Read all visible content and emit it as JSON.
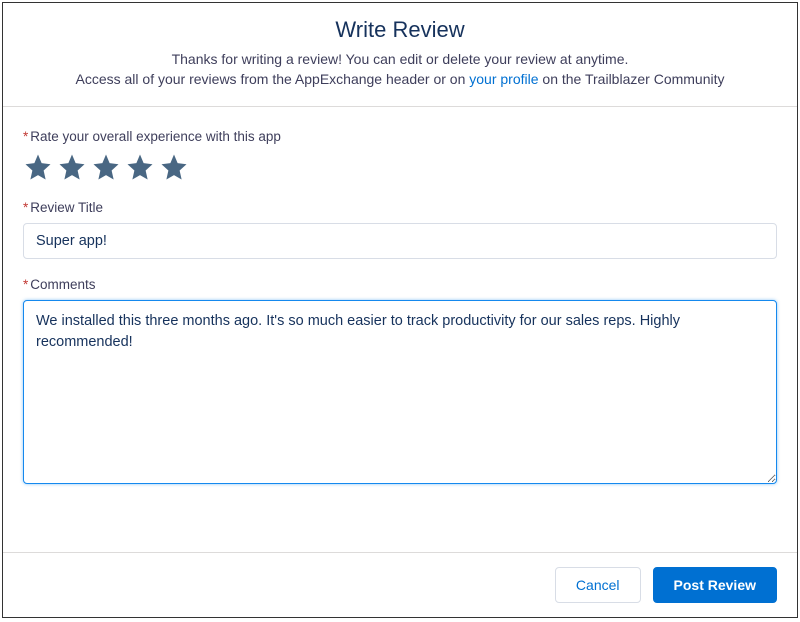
{
  "header": {
    "title": "Write Review",
    "line1": "Thanks for writing a review! You can edit or delete your review at anytime.",
    "line2a": "Access all of your reviews from the AppExchange header or on ",
    "profile_link": "your profile",
    "line2b": " on the Trailblazer Community"
  },
  "rating": {
    "label": "Rate your overall experience with this app",
    "value": 5,
    "max": 5
  },
  "title_field": {
    "label": "Review Title",
    "value": "Super app!"
  },
  "comments": {
    "label": "Comments",
    "value": "We installed this three months ago. It's so much easier to track productivity for our sales reps. Highly recommended!"
  },
  "footer": {
    "cancel": "Cancel",
    "post": "Post Review"
  }
}
